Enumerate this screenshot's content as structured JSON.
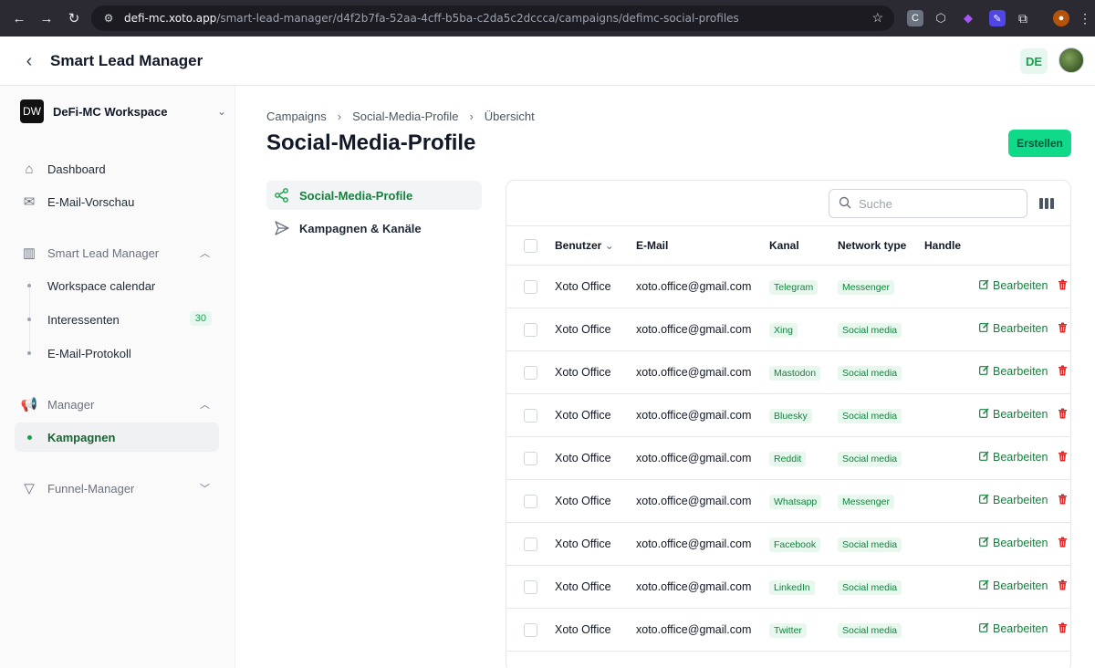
{
  "browser": {
    "url_host": "defi-mc.xoto.app",
    "url_path": "/smart-lead-manager/d4f2b7fa-52aa-4cff-b5ba-c2da5c2dccca/campaigns/defimc-social-profiles",
    "ext_c": "C"
  },
  "header": {
    "title": "Smart Lead Manager",
    "lang": "DE"
  },
  "sidebar": {
    "workspace_logo": "DW",
    "workspace_name": "DeFi-MC Workspace",
    "dashboard": "Dashboard",
    "email_preview": "E-Mail-Vorschau",
    "group_slm": "Smart Lead Manager",
    "workspace_calendar": "Workspace calendar",
    "interessenten": "Interessenten",
    "interessenten_count": "30",
    "email_log": "E-Mail-Protokoll",
    "group_manager": "Manager",
    "kampagnen": "Kampagnen",
    "group_funnel": "Funnel-Manager"
  },
  "breadcrumb": [
    "Campaigns",
    "Social-Media-Profile",
    "Übersicht"
  ],
  "page_title": "Social-Media-Profile",
  "create_label": "Erstellen",
  "subnav": {
    "social_profiles": "Social-Media-Profile",
    "campaigns_channels": "Kampagnen & Kanäle"
  },
  "search": {
    "placeholder": "Suche",
    "value": ""
  },
  "table": {
    "headers": {
      "user": "Benutzer",
      "email": "E-Mail",
      "channel": "Kanal",
      "network_type": "Network type",
      "handle": "Handle"
    },
    "edit_label": "Bearbeiten",
    "rows": [
      {
        "user": "Xoto Office",
        "email": "xoto.office@gmail.com",
        "channel": "Telegram",
        "network_type": "Messenger",
        "handle": ""
      },
      {
        "user": "Xoto Office",
        "email": "xoto.office@gmail.com",
        "channel": "Xing",
        "network_type": "Social media",
        "handle": ""
      },
      {
        "user": "Xoto Office",
        "email": "xoto.office@gmail.com",
        "channel": "Mastodon",
        "network_type": "Social media",
        "handle": ""
      },
      {
        "user": "Xoto Office",
        "email": "xoto.office@gmail.com",
        "channel": "Bluesky",
        "network_type": "Social media",
        "handle": ""
      },
      {
        "user": "Xoto Office",
        "email": "xoto.office@gmail.com",
        "channel": "Reddit",
        "network_type": "Social media",
        "handle": ""
      },
      {
        "user": "Xoto Office",
        "email": "xoto.office@gmail.com",
        "channel": "Whatsapp",
        "network_type": "Messenger",
        "handle": ""
      },
      {
        "user": "Xoto Office",
        "email": "xoto.office@gmail.com",
        "channel": "Facebook",
        "network_type": "Social media",
        "handle": ""
      },
      {
        "user": "Xoto Office",
        "email": "xoto.office@gmail.com",
        "channel": "LinkedIn",
        "network_type": "Social media",
        "handle": ""
      },
      {
        "user": "Xoto Office",
        "email": "xoto.office@gmail.com",
        "channel": "Twitter",
        "network_type": "Social media",
        "handle": ""
      }
    ]
  },
  "colors": {
    "accent": "#10d98a",
    "accent_text": "#15803d",
    "tag_bg": "#e8f8ef",
    "danger": "#dc2626"
  }
}
